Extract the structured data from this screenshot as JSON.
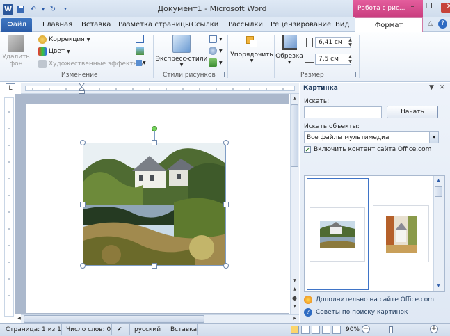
{
  "window": {
    "title": "Документ1 - Microsoft Word",
    "context_tab": "Работа с рис..."
  },
  "tabs": {
    "file": "Файл",
    "home": "Главная",
    "insert": "Вставка",
    "page_layout": "Разметка страницы",
    "references": "Ссылки",
    "mailings": "Рассылки",
    "review": "Рецензирование",
    "view": "Вид",
    "format": "Формат"
  },
  "ribbon": {
    "remove_bg": "Удалить фон",
    "correction": "Коррекция",
    "color": "Цвет",
    "artistic": "Художественные эффекты",
    "group_adjust": "Изменение",
    "quick_styles": "Экспресс-стили",
    "group_styles": "Стили рисунков",
    "arrange": "Упорядочить",
    "crop": "Обрезка",
    "height": "6,41 см",
    "width": "7,5 см",
    "group_size": "Размер"
  },
  "pane": {
    "title": "Картинка",
    "search_label": "Искать:",
    "search_value": "",
    "go_button": "Начать",
    "filter_label": "Искать объекты:",
    "filter_value": "Все файлы мультимедиа",
    "include_label": "Включить контент сайта Office.com",
    "link_more": "Дополнительно на сайте Office.com",
    "link_tips": "Советы по поиску картинок"
  },
  "status": {
    "page": "Страница: 1 из 1",
    "words": "Число слов: 0",
    "language": "русский",
    "mode": "Вставка",
    "zoom": "90%"
  },
  "colors": {
    "accent": "#2b579a",
    "context": "#c93d7e"
  }
}
